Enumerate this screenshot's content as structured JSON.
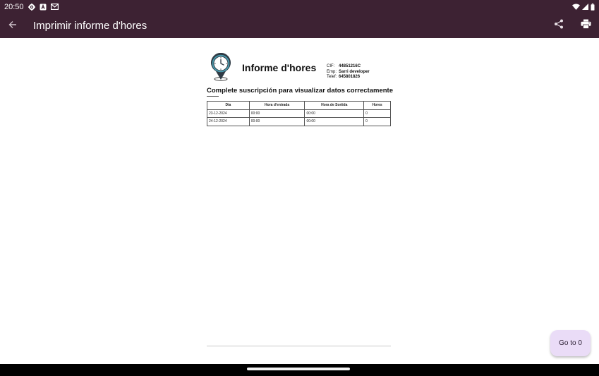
{
  "status_bar": {
    "time": "20:50",
    "left_icons": [
      "settings-icon",
      "app-notification-icon",
      "gmail-icon"
    ],
    "right_icons": [
      "wifi-icon",
      "signal-icon",
      "battery-icon"
    ]
  },
  "app_bar": {
    "title": "Imprimir informe d'hores",
    "actions": [
      "share-icon",
      "print-icon"
    ]
  },
  "document": {
    "title": "Informe d'hores",
    "company": {
      "cif_label": "CIF:",
      "cif_value": "44851216C",
      "emp_label": "Emp:",
      "emp_value": "Sarri developer",
      "phone_label": "Telef:",
      "phone_value": "645801826"
    },
    "notice": "Complete suscripción para visualizar datos correctamente",
    "table": {
      "headers": [
        "Dia",
        "Hora d'entrada",
        "Hora de Sortida",
        "Hores"
      ],
      "rows": [
        [
          "23-12-2024",
          "00:00",
          "00:00",
          "0"
        ],
        [
          "24-12-2024",
          "00:00",
          "00:00",
          "0"
        ]
      ]
    }
  },
  "fab": {
    "label": "Go to 0"
  },
  "colors": {
    "app_bar": "#3d2233",
    "fab": "#eadcf7",
    "logo_ring": "#4a9db0"
  }
}
